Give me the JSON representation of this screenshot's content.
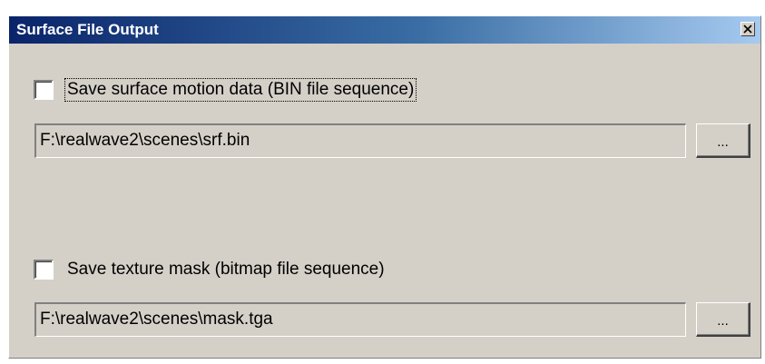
{
  "window": {
    "title": "Surface File Output"
  },
  "surface_motion": {
    "checkbox_label": "Save surface motion data (BIN file sequence)",
    "checked": false,
    "path": "F:\\realwave2\\scenes\\srf.bin",
    "browse_label": "..."
  },
  "texture_mask": {
    "checkbox_label": "Save texture mask (bitmap file sequence)",
    "checked": false,
    "path": "F:\\realwave2\\scenes\\mask.tga",
    "browse_label": "..."
  },
  "colors": {
    "dialog_face": "#d4d0c8",
    "title_bar_start": "#0a246a",
    "title_bar_end": "#a6caf0",
    "title_text": "#ffffff"
  },
  "icons": {
    "close": "close-icon"
  }
}
